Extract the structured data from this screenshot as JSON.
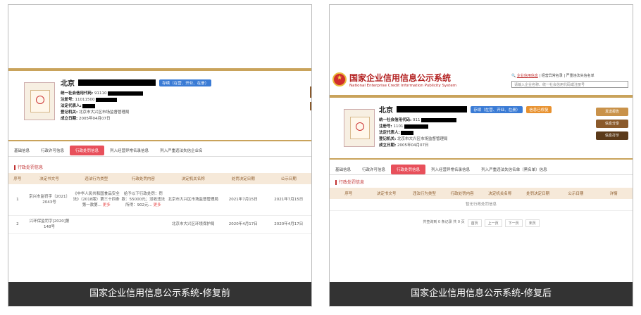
{
  "captions": {
    "before": "国家企业信用信息公示系统-修复前",
    "after": "国家企业信用信息公示系统-修复后"
  },
  "before": {
    "company_prefix": "北京",
    "status_badge": "存续（在营、开业、在册）",
    "fields": {
      "credit_code_label": "统一社会信用代码:",
      "credit_code_value": "91110",
      "reg_no_label": "注册号:",
      "reg_no_value": "11011500",
      "legal_rep_label": "法定代表人:",
      "reg_authority_label": "登记机关:",
      "reg_authority_value": "北京市大兴区市场监督管理局",
      "founded_label": "成立日期:",
      "founded_value": "2005年04月07日"
    },
    "tabs": [
      "基础信息",
      "行政许可信息",
      "行政处罚信息",
      "列入经营异常名录信息",
      "列入严重违法失信企业名"
    ],
    "active_tab_index": 2,
    "section_title": "行政处罚信息",
    "table": {
      "headers": [
        "序号",
        "决定书文号",
        "违法行为类型",
        "行政处罚内容",
        "决定机关名称",
        "处罚决定日期",
        "公示日期"
      ],
      "rows": [
        [
          "1",
          "京兴市监罚字〔2021〕2043号",
          "《中华人民共和国食品安全法》（2018版）第三十四条第一款第...",
          "给予以下行政处罚：罚款：55000元；没收违法所得：902元...",
          "北京市大兴区市场监督管理局",
          "2021年7月15日",
          "2021年7月15日"
        ],
        [
          "2",
          "兴环保监罚字[2020]第148号",
          "",
          "",
          "北京市大兴区环境保护局",
          "2020年4月17日",
          "2020年4月17日"
        ]
      ],
      "more_label": "更多"
    }
  },
  "after": {
    "system_title": "国家企业信用信息公示系统",
    "system_subtitle": "National Enterprise Credit Information Publicity System",
    "header_links": [
      "企业信用信息",
      "经营异常名录",
      "严重违法失信名单"
    ],
    "search_placeholder": "请输入企业名称、统一社会信用代码或注册号",
    "company_prefix": "北京",
    "status_badge": "存续（在营、开业、在册）",
    "status_badge2": "信息已修复",
    "fields": {
      "credit_code_label": "统一社会信用代码:",
      "credit_code_value": "911",
      "reg_no_label": "注册号:",
      "reg_no_value": "1101",
      "legal_rep_label": "法定代表人:",
      "reg_authority_label": "登记机关:",
      "reg_authority_value": "北京市大兴区市场监督管理局",
      "founded_label": "成立日期:",
      "founded_value": "2005年04月07日"
    },
    "side_buttons": [
      "发送报告",
      "信息分享",
      "信息打印"
    ],
    "tabs": [
      "基础信息",
      "行政许可信息",
      "行政处罚信息",
      "列入经营异常名录信息",
      "列入严重违法失信名单（黑名单）信息"
    ],
    "active_tab_index": 2,
    "section_title": "行政处罚信息",
    "table": {
      "headers": [
        "序号",
        "决定书文号",
        "违法行为类型",
        "行政处罚内容",
        "决定机关名称",
        "处罚决定日期",
        "公示日期",
        "详情"
      ],
      "empty_text": "暂无行政处罚信息"
    },
    "pager": {
      "summary": "共查询到 0 条记录 共 0 页",
      "buttons": [
        "首页",
        "上一页",
        "下一页",
        "末页"
      ]
    }
  },
  "colors": {
    "gold_bar": "#c9a35b",
    "active_tab": "#e8505b",
    "status_blue": "#3a7bd5",
    "caption_bg": "#333333",
    "brand_red": "#b32020"
  }
}
